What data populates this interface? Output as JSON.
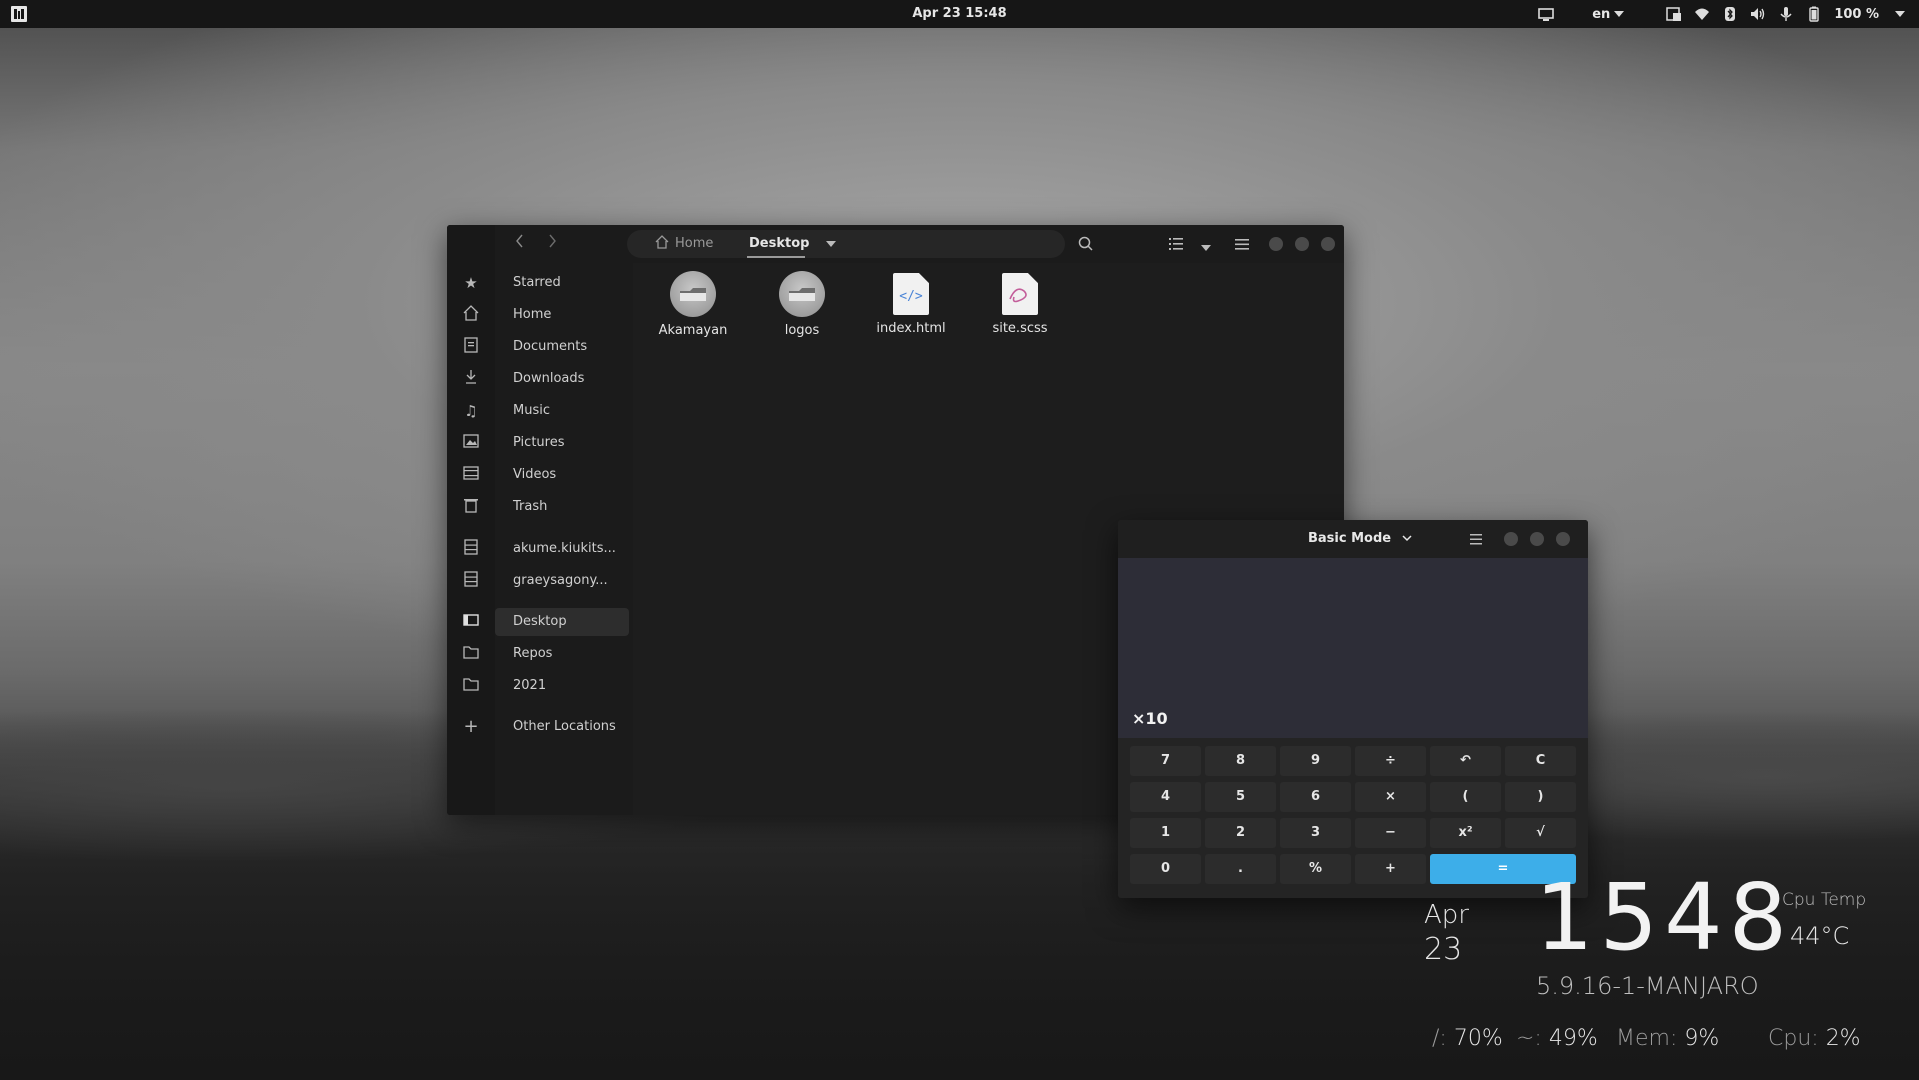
{
  "topbar": {
    "clock": "Apr 23  15:48",
    "language": "en",
    "battery": "100 %",
    "icons": [
      "activities-icon",
      "screen-icon",
      "display-icon",
      "wifi-icon",
      "bluetooth-icon",
      "volume-icon",
      "microphone-icon",
      "battery-icon"
    ]
  },
  "files": {
    "path": {
      "home": "Home",
      "current": "Desktop"
    },
    "sidebar": [
      {
        "label": "Starred",
        "icon": "star-icon"
      },
      {
        "label": "Home",
        "icon": "home-icon"
      },
      {
        "label": "Documents",
        "icon": "documents-icon"
      },
      {
        "label": "Downloads",
        "icon": "downloads-icon"
      },
      {
        "label": "Music",
        "icon": "music-icon"
      },
      {
        "label": "Pictures",
        "icon": "pictures-icon"
      },
      {
        "label": "Videos",
        "icon": "videos-icon"
      },
      {
        "label": "Trash",
        "icon": "trash-icon"
      },
      {
        "label": "akume.kiukits...",
        "icon": "network-drive-icon"
      },
      {
        "label": "graeysagony...",
        "icon": "network-drive-icon"
      },
      {
        "label": "Desktop",
        "icon": "desktop-icon"
      },
      {
        "label": "Repos",
        "icon": "folder-icon"
      },
      {
        "label": "2021",
        "icon": "folder-icon"
      },
      {
        "label": "Other Locations",
        "icon": "plus-icon"
      }
    ],
    "items": [
      {
        "name": "Akamayan",
        "type": "folder"
      },
      {
        "name": "logos",
        "type": "folder"
      },
      {
        "name": "index.html",
        "type": "html"
      },
      {
        "name": "site.scss",
        "type": "scss"
      }
    ]
  },
  "calculator": {
    "mode": "Basic Mode",
    "expression": "×10",
    "keys": [
      [
        "7",
        "8",
        "9",
        "÷",
        "↶",
        "C"
      ],
      [
        "4",
        "5",
        "6",
        "×",
        "(",
        ")"
      ],
      [
        "1",
        "2",
        "3",
        "−",
        "x²",
        "√"
      ],
      [
        "0",
        ".",
        "%",
        "+",
        "="
      ]
    ]
  },
  "conky": {
    "time": "15:48",
    "time_display": "1548",
    "month": "Apr",
    "day": "23",
    "kernel": "5.9.16-1-MANJARO",
    "cpu_temp_label": "Cpu Temp",
    "cpu_temp": "44°C",
    "stats": [
      {
        "label": "/:",
        "value": "70%"
      },
      {
        "label": "~:",
        "value": "49%"
      },
      {
        "label": "Mem:",
        "value": "9%"
      },
      {
        "label": "Cpu:",
        "value": "2%"
      }
    ]
  },
  "colors": {
    "accent": "#3daee9",
    "panel": "#161616",
    "window": "#1d1d1d",
    "display": "#2d2d37"
  }
}
